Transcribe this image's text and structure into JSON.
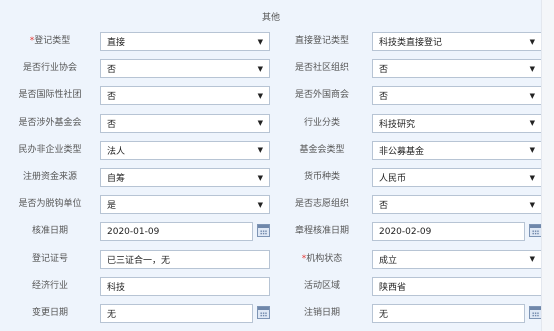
{
  "section": {
    "title": "其他"
  },
  "rows": [
    {
      "left": {
        "label": "登记类型",
        "required": true,
        "value": "直接",
        "kind": "select"
      },
      "right": {
        "label": "直接登记类型",
        "required": false,
        "value": "科技类直接登记",
        "kind": "select"
      }
    },
    {
      "left": {
        "label": "是否行业协会",
        "value": "否",
        "kind": "select"
      },
      "right": {
        "label": "是否社区组织",
        "value": "否",
        "kind": "select"
      }
    },
    {
      "left": {
        "label": "是否国际性社团",
        "value": "否",
        "kind": "select"
      },
      "right": {
        "label": "是否外国商会",
        "value": "否",
        "kind": "select"
      }
    },
    {
      "left": {
        "label": "是否涉外基金会",
        "value": "否",
        "kind": "select"
      },
      "right": {
        "label": "行业分类",
        "value": "科技研究",
        "kind": "select"
      }
    },
    {
      "left": {
        "label": "民办非企业类型",
        "value": "法人",
        "kind": "select"
      },
      "right": {
        "label": "基金会类型",
        "value": "非公募基金",
        "kind": "select"
      }
    },
    {
      "left": {
        "label": "注册资金来源",
        "value": "自筹",
        "kind": "select"
      },
      "right": {
        "label": "货币种类",
        "value": "人民币",
        "kind": "select"
      }
    },
    {
      "left": {
        "label": "是否为脱钩单位",
        "value": "是",
        "kind": "select"
      },
      "right": {
        "label": "是否志愿组织",
        "value": "否",
        "kind": "select"
      }
    },
    {
      "left": {
        "label": "核准日期",
        "value": "2020-01-09",
        "kind": "date"
      },
      "right": {
        "label": "章程核准日期",
        "value": "2020-02-09",
        "kind": "date"
      }
    },
    {
      "left": {
        "label": "登记证号",
        "value": "已三证合一，无",
        "kind": "text"
      },
      "right": {
        "label": "机构状态",
        "required": true,
        "value": "成立",
        "kind": "select"
      }
    },
    {
      "left": {
        "label": "经济行业",
        "value": "科技",
        "kind": "text"
      },
      "right": {
        "label": "活动区域",
        "value": "陕西省",
        "kind": "text"
      }
    },
    {
      "left": {
        "label": "变更日期",
        "value": "无",
        "kind": "date"
      },
      "right": {
        "label": "注销日期",
        "value": "无",
        "kind": "date"
      }
    }
  ]
}
